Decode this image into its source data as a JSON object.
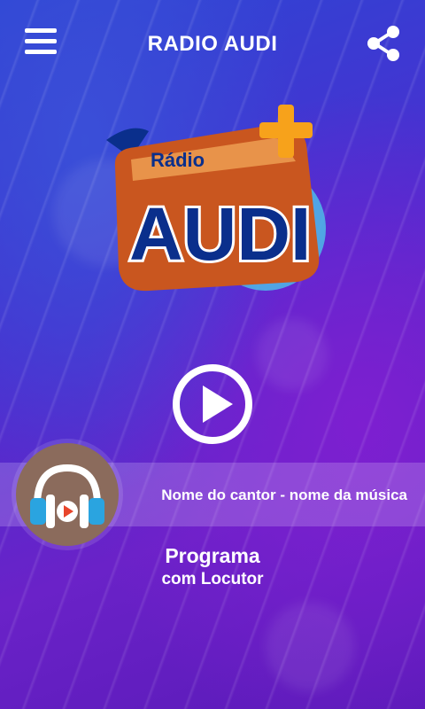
{
  "header": {
    "title": "RADIO AUDI",
    "menu_icon": "hamburger-menu-icon",
    "share_icon": "share-icon"
  },
  "logo": {
    "small_text": "Rádio",
    "big_text": "AUDI",
    "plus_color": "#f7a21b",
    "brand_blue": "#0a2f8c",
    "brand_orange": "#c9561f"
  },
  "player": {
    "play_icon": "play-icon"
  },
  "now_playing": {
    "song": "Nome do cantor - nome da música",
    "avatar_icon": "headphones-icon"
  },
  "program": {
    "line1": "Programa",
    "line2": "com Locutor"
  },
  "colors": {
    "background_top": "#2c46d4",
    "background_bottom": "#6a22c8",
    "text": "#ffffff"
  }
}
